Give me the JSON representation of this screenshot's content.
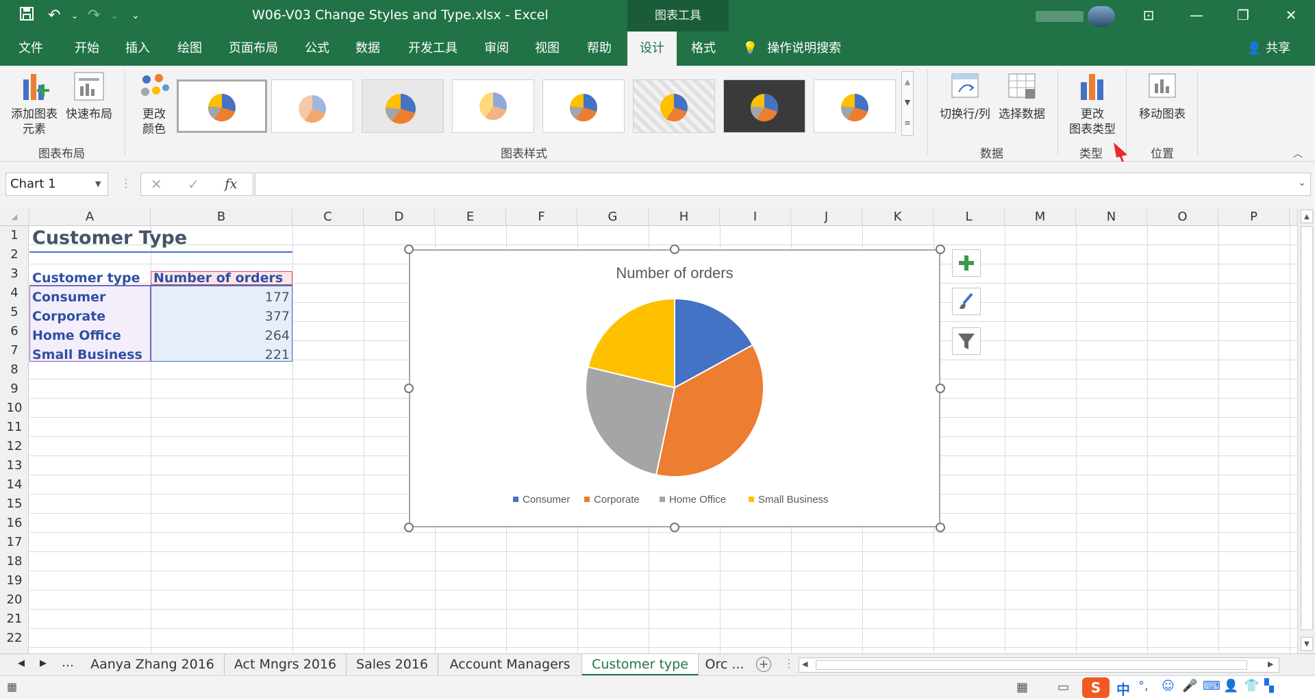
{
  "titlebar": {
    "title": "W06-V03 Change Styles and Type.xlsx  -  Excel",
    "context_tab": "图表工具",
    "save_icon": "save-icon",
    "undo_icon": "undo-icon",
    "redo_icon": "redo-icon",
    "customize_icon": "customize-quick-access-icon"
  },
  "tabs": [
    "文件",
    "开始",
    "插入",
    "绘图",
    "页面布局",
    "公式",
    "数据",
    "开发工具",
    "审阅",
    "视图",
    "帮助",
    "设计",
    "格式"
  ],
  "active_tab": "设计",
  "search_label": "操作说明搜索",
  "share_label": "共享",
  "ribbon": {
    "add_element": [
      "添加图表",
      "元素"
    ],
    "quick_layout": "快速布局",
    "change_colors": [
      "更改",
      "颜色"
    ],
    "switch_row_col": "切换行/列",
    "select_data": "选择数据",
    "change_type": [
      "更改",
      "图表类型"
    ],
    "move_chart": "移动图表",
    "groups": {
      "layout": "图表布局",
      "styles": "图表样式",
      "data": "数据",
      "type": "类型",
      "location": "位置"
    }
  },
  "formula": {
    "name_box": "Chart 1",
    "fx": "fx",
    "value": ""
  },
  "columns": [
    "A",
    "B",
    "C",
    "D",
    "E",
    "F",
    "G",
    "H",
    "I",
    "J",
    "K",
    "L",
    "M",
    "N",
    "O",
    "P"
  ],
  "rows": [
    "1",
    "2",
    "3",
    "4",
    "5",
    "6",
    "7",
    "8",
    "9",
    "10",
    "11",
    "12",
    "13",
    "14",
    "15",
    "16",
    "17",
    "18",
    "19",
    "20",
    "21",
    "22"
  ],
  "sheet": {
    "title": "Customer Type",
    "header_a": "Customer type",
    "header_b": "Number of orders",
    "data": [
      {
        "type": "Consumer",
        "orders": "177"
      },
      {
        "type": "Corporate",
        "orders": "377"
      },
      {
        "type": "Home Office",
        "orders": "264"
      },
      {
        "type": "Small Business",
        "orders": "221"
      }
    ]
  },
  "chart_data": {
    "type": "pie",
    "title": "Number of orders",
    "categories": [
      "Consumer",
      "Corporate",
      "Home Office",
      "Small Business"
    ],
    "values": [
      177,
      377,
      264,
      221
    ],
    "colors": [
      "#4472c4",
      "#ed7d31",
      "#a5a5a5",
      "#ffc000"
    ],
    "legend": "bottom"
  },
  "sheet_tabs": [
    "Aanya Zhang 2016",
    "Act Mngrs 2016",
    "Sales 2016",
    "Account Managers",
    "Customer type",
    "Orc ..."
  ],
  "active_sheet": "Customer type",
  "ime": "中"
}
